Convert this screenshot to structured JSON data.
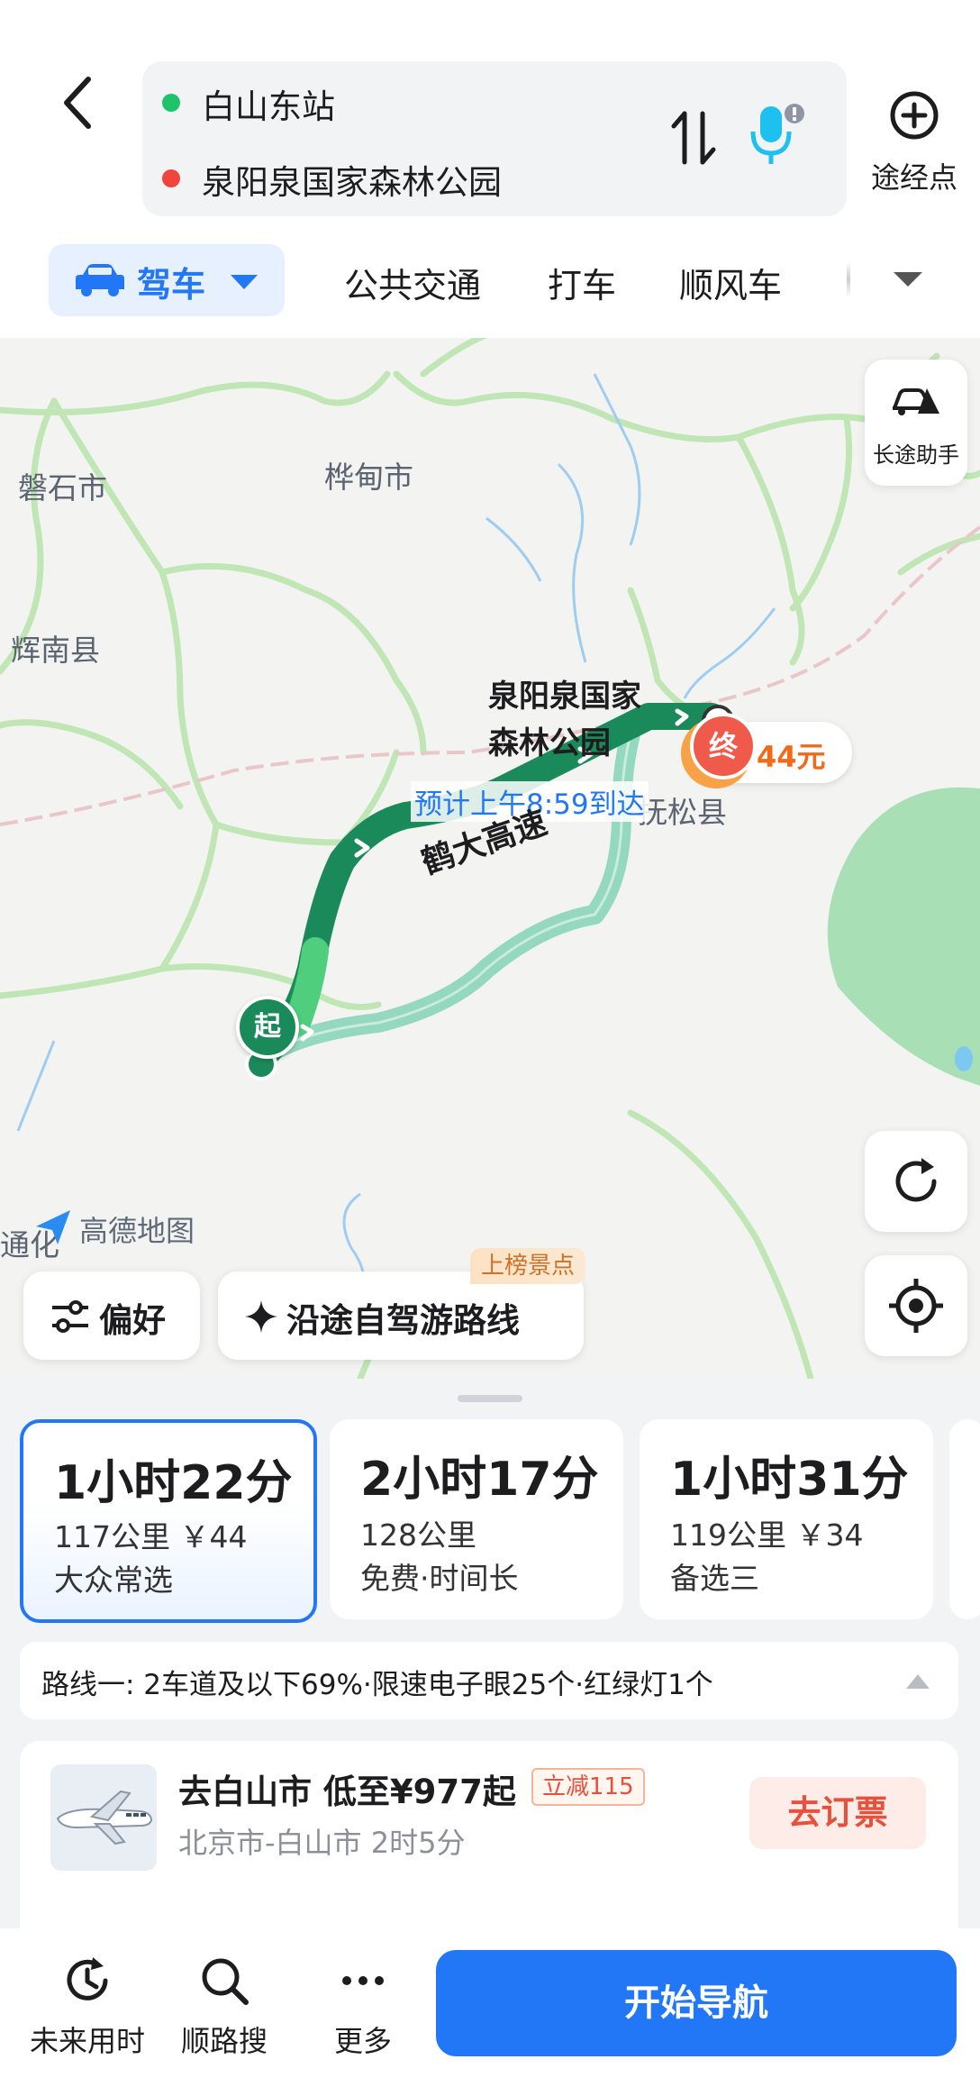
{
  "header": {
    "origin": "白山东站",
    "destination": "泉阳泉国家森林公园",
    "waypoint_label": "途经点"
  },
  "modes": {
    "drive": "驾车",
    "transit": "公共交通",
    "taxi": "打车",
    "carpool": "顺风车"
  },
  "map": {
    "labels": {
      "panshi": "磐石市",
      "huadian": "桦甸市",
      "huinan": "辉南县",
      "fusong": "抚松县",
      "tonghua": "通化"
    },
    "destination_name_line1": "泉阳泉国家",
    "destination_name_line2": "森林公园",
    "end_marker": "终",
    "toll_fee": "44元",
    "eta_text": "预计上午8:59到达",
    "highway_label": "鹤大高速",
    "start_marker": "起",
    "logo_text": "高德地图",
    "long_trip_assistant": "长途助手",
    "preference_button": "偏好",
    "scenic_route_button": "沿途自驾游路线",
    "scenic_badge": "上榜景点"
  },
  "routes": [
    {
      "time": "1小时22分",
      "line1": "117公里 ￥44",
      "line2": "大众常选"
    },
    {
      "time": "2小时17分",
      "line1": "128公里",
      "line2": "免费·时间长"
    },
    {
      "time": "1小时31分",
      "line1": "119公里 ￥34",
      "line2": "备选三"
    }
  ],
  "summary": "路线一:  2车道及以下69%·限速电子眼25个·红绿灯1个",
  "promo": {
    "title": "去白山市 低至¥977起",
    "badge": "立减115",
    "subtitle": "北京市-白山市 2时5分",
    "button": "去订票"
  },
  "bottom_nav": {
    "future_time": "未来用时",
    "along_search": "顺路搜",
    "more": "更多",
    "start_navigation": "开始导航"
  },
  "colors": {
    "accent": "#2277f6",
    "route_main": "#1b8a5a",
    "route_alt": "#93d8bf",
    "dest_red": "#f05a4a",
    "promo_red": "#e8503c"
  }
}
